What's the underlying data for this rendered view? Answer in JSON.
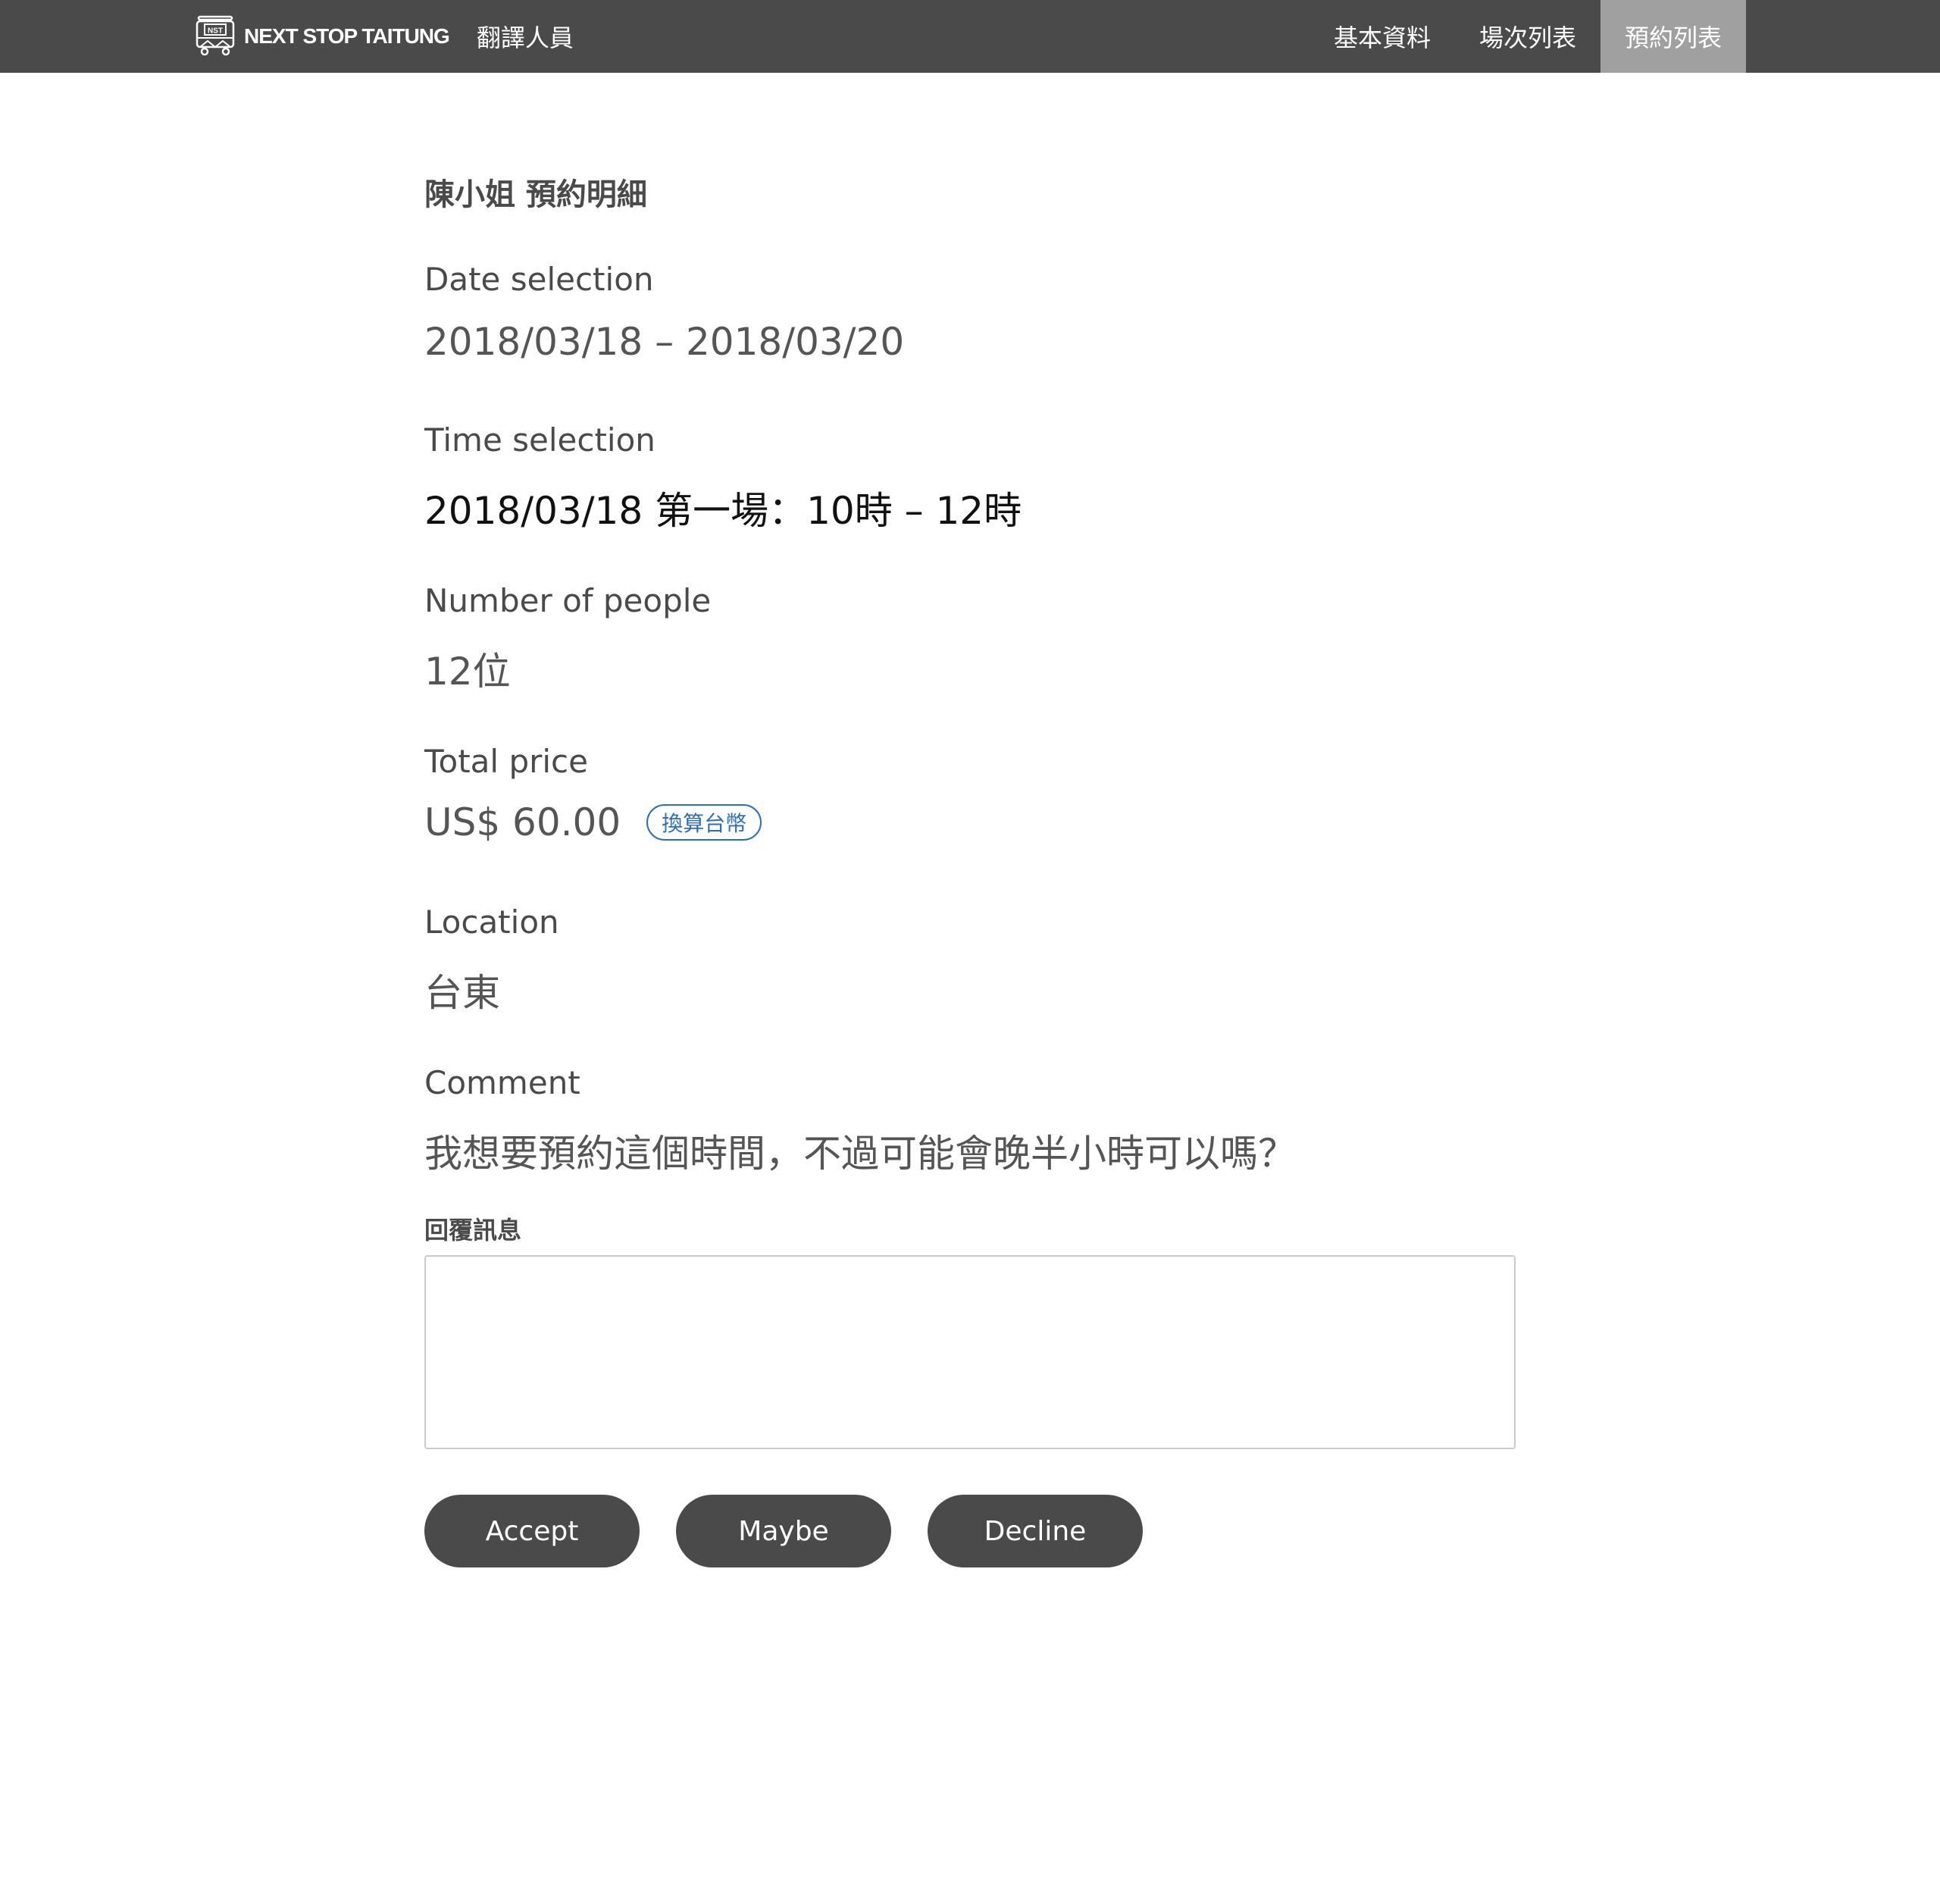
{
  "navbar": {
    "brand_text": "NEXT STOP TAITUNG",
    "logo_text": "NST",
    "role": "翻譯人員",
    "items": [
      {
        "label": "基本資料",
        "active": false
      },
      {
        "label": "場次列表",
        "active": false
      },
      {
        "label": "預約列表",
        "active": true
      }
    ],
    "bg_color": "#4a4a4a",
    "active_color": "#a0a0a0"
  },
  "page": {
    "title": "陳小姐 預約明細"
  },
  "fields": {
    "date": {
      "label": "Date selection",
      "value": "2018/03/18 – 2018/03/20"
    },
    "time": {
      "label": "Time selection",
      "value": "2018/03/18 第一場：10時 – 12時"
    },
    "people": {
      "label": "Number of people",
      "value": "12位"
    },
    "price": {
      "label": "Total price",
      "value": "US$ 60.00",
      "convert_label": "換算台幣"
    },
    "location": {
      "label": "Location",
      "value": "台東"
    },
    "comment": {
      "label": "Comment",
      "value": "我想要預約這個時間，不過可能會晚半小時可以嗎？"
    }
  },
  "reply": {
    "label": "回覆訊息",
    "value": "",
    "placeholder": ""
  },
  "actions": {
    "accept": "Accept",
    "maybe": "Maybe",
    "decline": "Decline"
  },
  "colors": {
    "accent_link": "#2f6db5",
    "button_bg": "#4a4a4a"
  }
}
